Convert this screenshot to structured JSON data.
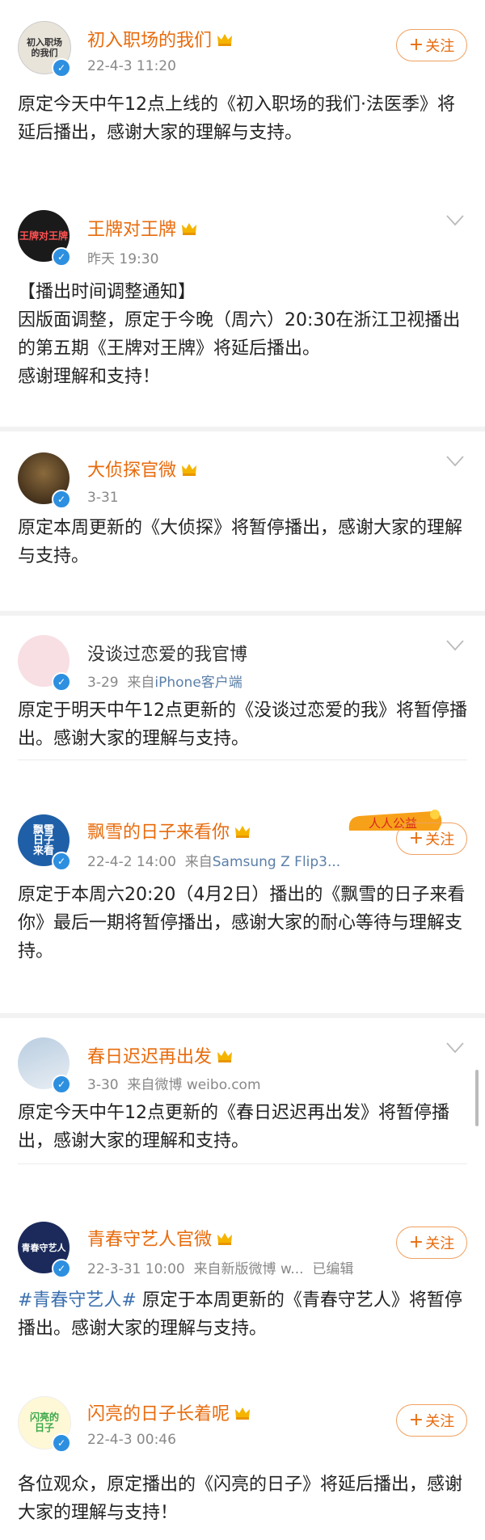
{
  "posts": [
    {
      "name": "初入职场的我们",
      "avatar_text": "初入职场\n的我们",
      "meta": "22-4-3 11:20",
      "source": "",
      "edited": "",
      "follow_label": "关注",
      "text": "原定今天中午12点上线的《初入职场的我们·法医季》将延后播出，感谢大家的理解与支持。"
    },
    {
      "name": "王牌对王牌",
      "avatar_text": "王牌对王牌",
      "meta": "昨天 19:30",
      "source": "",
      "edited": "",
      "follow_label": "",
      "text_lines": [
        "【播出时间调整通知】",
        "因版面调整，原定于今晚（周六）20:30在浙江卫视播出的第五期《王牌对王牌》将延后播出。",
        "感谢理解和支持！"
      ]
    },
    {
      "name": "大侦探官微",
      "avatar_text": "",
      "meta": "3-31",
      "source": "",
      "edited": "",
      "follow_label": "",
      "text": "原定本周更新的《大侦探》将暂停播出，感谢大家的理解与支持。"
    },
    {
      "name": "没谈过恋爱的我官博",
      "avatar_text": "",
      "meta": "3-29",
      "source_prefix": "来自",
      "source": "iPhone客户端",
      "edited": "",
      "follow_label": "",
      "text": "原定于明天中午12点更新的《没谈过恋爱的我》将暂停播出。感谢大家的理解与支持。"
    },
    {
      "name": "飘雪的日子来看你",
      "avatar_text": "飘雪\n日子\n来看",
      "meta": "22-4-2 14:00",
      "source_prefix": "来自",
      "source": "Samsung Z Flip3...",
      "edited": "",
      "follow_label": "关注",
      "sticker_text": "人人公益",
      "text": "原定于本周六20:20（4月2日）播出的《飘雪的日子来看你》最后一期将暂停播出，感谢大家的耐心等待与理解支持。"
    },
    {
      "name": "春日迟迟再出发",
      "avatar_text": "",
      "meta": "3-30",
      "source_prefix": "来自微博",
      "source": "weibo.com",
      "edited": "",
      "follow_label": "",
      "text": "原定今天中午12点更新的《春日迟迟再出发》将暂停播出，感谢大家的理解和支持。"
    },
    {
      "name": "青春守艺人官微",
      "avatar_text": "青春守艺人",
      "meta": "22-3-31 10:00",
      "source_prefix": "来自新版微博 w...",
      "source": "",
      "edited": "已编辑",
      "follow_label": "关注",
      "hashtag": "#青春守艺人#",
      "text": "原定于本周更新的《青春守艺人》将暂停播出。感谢大家的理解与支持。"
    },
    {
      "name": "闪亮的日子长着呢",
      "avatar_text": "闪亮的\n日子",
      "meta": "22-4-3 00:46",
      "source": "",
      "edited": "",
      "follow_label": "关注",
      "text": "各位观众，原定播出的《闪亮的日子》将延后播出，感谢大家的理解与支持！"
    }
  ],
  "icons": {
    "crown": "crown-icon",
    "verified": "verified-icon",
    "chevron": "chevron-down-icon",
    "plus": "plus-icon"
  },
  "colors": {
    "name": "#e86b0c",
    "verified": "#2d8fe0",
    "source": "#5b7fa8",
    "hashtag": "#3a6fb0"
  }
}
